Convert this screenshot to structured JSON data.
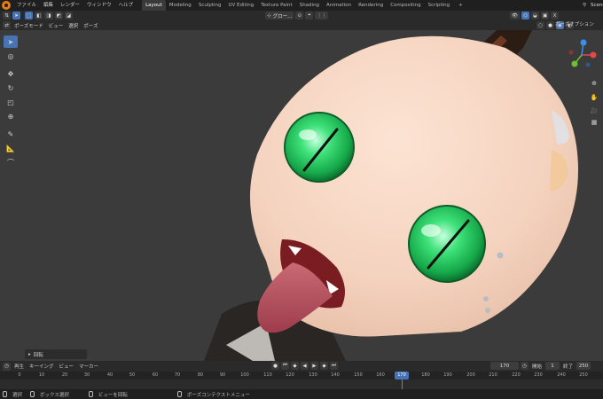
{
  "menubar": {
    "items": [
      "ファイル",
      "編集",
      "レンダー",
      "ウィンドウ",
      "ヘルプ"
    ],
    "workspaces": [
      "Layout",
      "Modeling",
      "Sculpting",
      "UV Editing",
      "Texture Paint",
      "Shading",
      "Animation",
      "Rendering",
      "Compositing",
      "Scripting"
    ],
    "active_workspace": "Layout",
    "scene_label": "Scene"
  },
  "header": {
    "mode": "ポーズモード",
    "menus": [
      "ビュー",
      "選択",
      "ポーズ"
    ],
    "transform_orientation": "グロー...",
    "pose_options": "ポーズオプション"
  },
  "operator_panel": {
    "label": "回転"
  },
  "timeline": {
    "menus": [
      "再生",
      "キーイング",
      "ビュー",
      "マーカー"
    ],
    "current_frame": "170",
    "start_label": "開始",
    "start": "1",
    "end_label": "終了",
    "end": "250",
    "ticks": [
      "0",
      "10",
      "20",
      "30",
      "40",
      "50",
      "60",
      "70",
      "80",
      "90",
      "100",
      "110",
      "120",
      "130",
      "140",
      "150",
      "160",
      "170",
      "180",
      "190",
      "200",
      "210",
      "220",
      "230",
      "240",
      "250"
    ]
  },
  "statusbar": {
    "select": "選択",
    "box_select": "ボックス選択",
    "rotate_view": "ビューを回転",
    "context_menu": "ポーズコンテクストメニュー"
  },
  "colors": {
    "accent": "#4772b3",
    "skin": "#f4d6c4",
    "eye": "#2fcf5f",
    "tongue": "#b84f5e",
    "viewport": "#3b3b3b"
  }
}
